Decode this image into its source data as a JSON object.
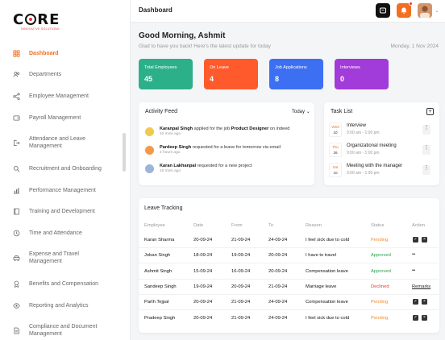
{
  "logo": {
    "text_left": "C",
    "text_right": "RE",
    "tagline": "INNOVATIVE SOLUTIONS"
  },
  "sidebar": {
    "items": [
      {
        "label": "Dashboard",
        "icon": "grid-icon",
        "active": true
      },
      {
        "label": "Departments",
        "icon": "users-icon"
      },
      {
        "label": "Employee Management",
        "icon": "share-icon"
      },
      {
        "label": "Payroll Management",
        "icon": "wallet-icon"
      },
      {
        "label": "Attendance and Leave Management",
        "icon": "logout-icon"
      },
      {
        "label": "Recruitment and Onboarding",
        "icon": "search-icon"
      },
      {
        "label": "Performance Management",
        "icon": "bar-chart-icon"
      },
      {
        "label": "Training and Development",
        "icon": "book-icon"
      },
      {
        "label": "Time and Attendance",
        "icon": "clock-icon"
      },
      {
        "label": "Expense and Travel Management",
        "icon": "car-icon"
      },
      {
        "label": "Benefits and Compensation",
        "icon": "award-icon"
      },
      {
        "label": "Reporting and Analytics",
        "icon": "eye-icon"
      },
      {
        "label": "Compliance and Document Management",
        "icon": "file-icon"
      }
    ]
  },
  "header": {
    "title": "Dashboard"
  },
  "greeting": {
    "title": "Good Morning, Ashmit",
    "subtitle": "Glad to have you back! Here's the latest update for today",
    "date": "Monday, 1 Nov 2024"
  },
  "stats": [
    {
      "label": "Total Employees",
      "value": "45",
      "color": "#2bb08a"
    },
    {
      "label": "On Leave",
      "value": "4",
      "color": "#ff5a2c"
    },
    {
      "label": "Job Applications",
      "value": "8",
      "color": "#3d6ff2"
    },
    {
      "label": "Interviews",
      "value": "0",
      "color": "#a13bd9"
    }
  ],
  "activity": {
    "title": "Activity Feed",
    "filter": "Today",
    "items": [
      {
        "name": "Karanpal Singh",
        "action": " applied for the job ",
        "target": "Product Designer",
        "suffix": " on indeed",
        "time": "10 mins ago"
      },
      {
        "name": "Pardeep Singh",
        "action": " requested for a leave for tomorrow via email",
        "target": "",
        "suffix": "",
        "time": "4 hours ago"
      },
      {
        "name": "Karan Lakhanpal",
        "action": " requested for a new project",
        "target": "",
        "suffix": "",
        "time": "10 mins ago"
      }
    ]
  },
  "tasks": {
    "title": "Task List",
    "items": [
      {
        "month": "Wed",
        "day": "10",
        "name": "Interview",
        "time": "9:00 am - 1:00 pm"
      },
      {
        "month": "Thu",
        "day": "26",
        "name": "Organizational meeting",
        "time": "9:00 am - 1:00 pm"
      },
      {
        "month": "Sat",
        "day": "10",
        "name": "Meeting with the manager",
        "time": "9:00 am - 1:00 pm"
      }
    ]
  },
  "leave": {
    "title": "Leave Tracking",
    "columns": [
      "Employee",
      "Date",
      "From",
      "To",
      "Reason",
      "Status",
      "Action"
    ],
    "rows": [
      {
        "employee": "Karan Sharma",
        "date": "20-09-24",
        "from": "21-09-24",
        "to": "24-09-24",
        "reason": "I feel sick due to cold",
        "status": "Pending",
        "action": "buttons"
      },
      {
        "employee": "Joban Singh",
        "date": "18-09-24",
        "from": "19-09-24",
        "to": "20-09-24",
        "reason": "I have to travel",
        "status": "Approved",
        "action": "dots"
      },
      {
        "employee": "Ashmit Singh",
        "date": "15-09-24",
        "from": "16-09-24",
        "to": "20-09-24",
        "reason": "Compensation leave",
        "status": "Approved",
        "action": "dots"
      },
      {
        "employee": "Sandeep Singh",
        "date": "19-09-24",
        "from": "20-09-24",
        "to": "21-09-24",
        "reason": "Marriage leave",
        "status": "Declined",
        "action": "Remarks"
      },
      {
        "employee": "Parth Tejpal",
        "date": "20-09-24",
        "from": "21-09-24",
        "to": "24-09-24",
        "reason": "Compensation leave",
        "status": "Pending",
        "action": "buttons"
      },
      {
        "employee": "Pradeep Singh",
        "date": "20-09-24",
        "from": "21-09-24",
        "to": "24-09-24",
        "reason": "I feel sick due to cold",
        "status": "Pending",
        "action": "buttons"
      }
    ]
  },
  "colors": {
    "accent": "#f26f21",
    "pending": "#f08c2e",
    "approved": "#2e9d4f",
    "declined": "#e53935"
  }
}
